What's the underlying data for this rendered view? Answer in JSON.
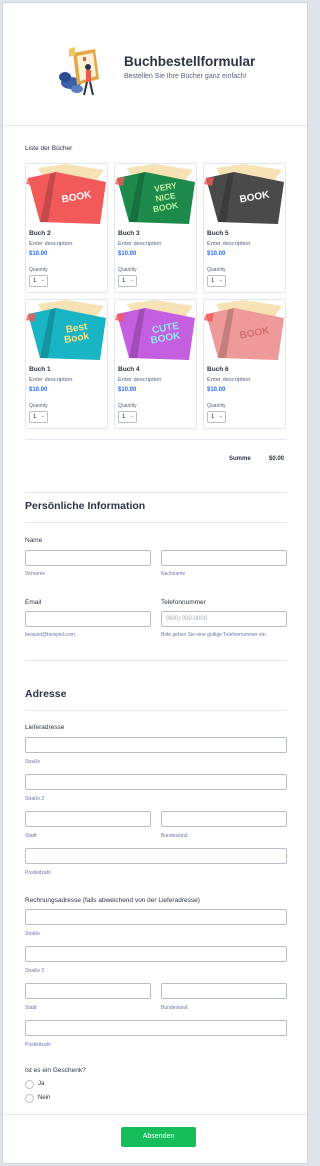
{
  "header": {
    "title": "Buchbestellformular",
    "subtitle": "Bestellen Sie Ihre Bücher ganz einfach!"
  },
  "products": {
    "section_label": "Liste der Bücher",
    "qty_label": "Quantity",
    "desc_placeholder": "Enter description",
    "items": [
      {
        "name": "Buch 2",
        "price": "$10.00",
        "qty": "1",
        "cover_color": "#f25a5a",
        "cover_text": "BOOK",
        "text_color": "#ffffff"
      },
      {
        "name": "Buch 3",
        "price": "$10.00",
        "qty": "1",
        "cover_color": "#1d8a4c",
        "cover_text": "VERY NICE BOOK",
        "text_color": "#b6f0a4"
      },
      {
        "name": "Buch 5",
        "price": "$10.00",
        "qty": "1",
        "cover_color": "#4a4a4a",
        "cover_text": "BOOK",
        "text_color": "#ffffff"
      },
      {
        "name": "Buch 1",
        "price": "$10.00",
        "qty": "1",
        "cover_color": "#19b5c4",
        "cover_text": "Best Book",
        "text_color": "#f7e27a"
      },
      {
        "name": "Buch 4",
        "price": "$10.00",
        "qty": "1",
        "cover_color": "#c45fe0",
        "cover_text": "CUTE BOOK",
        "text_color": "#8ee8f2"
      },
      {
        "name": "Buch 6",
        "price": "$10.00",
        "qty": "1",
        "cover_color": "#ee9a9a",
        "cover_text": "BOOK",
        "text_color": "#d46f6f"
      }
    ],
    "total_label": "Summe",
    "total_value": "$0.00"
  },
  "personal": {
    "title": "Persönliche Information",
    "name_label": "Name",
    "first_name_sub": "Vorname",
    "last_name_sub": "Nachname",
    "email_label": "Email",
    "email_sub": "beispiel@beispiel.com",
    "phone_label": "Telefonnummer",
    "phone_placeholder": "(000) 000-0000",
    "phone_sub": "Bitte geben Sie eine gültige Telefonnummer ein."
  },
  "address": {
    "title": "Adresse",
    "shipping_label": "Lieferadresse",
    "billing_label": "Rechnungsadresse (falls abweichend von der Lieferadresse)",
    "street_sub": "Straße",
    "street2_sub": "Straße 2",
    "city_sub": "Stadt",
    "state_sub": "Bundesland",
    "zip_sub": "Postleitzahl"
  },
  "gift": {
    "label": "Ist es ein Geschenk?",
    "options": [
      "Ja",
      "Nein"
    ]
  },
  "submit_label": "Absenden",
  "colors": {
    "accent": "#2e69ff",
    "submit": "#18bd5b"
  }
}
